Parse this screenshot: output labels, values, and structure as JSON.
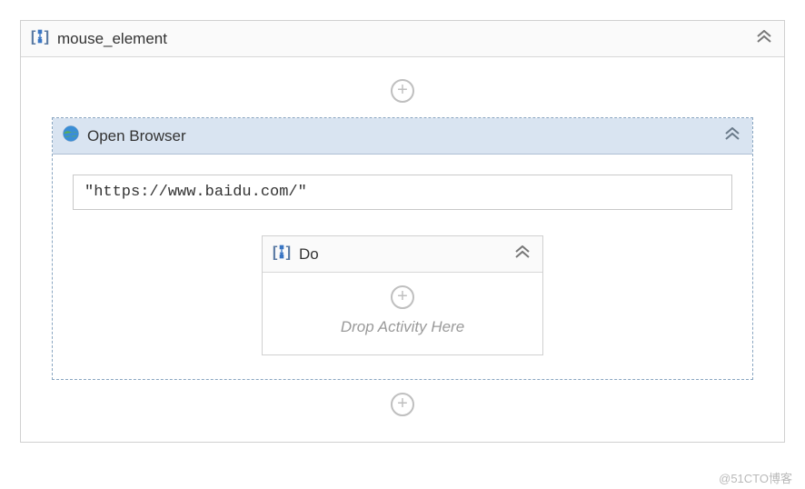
{
  "root": {
    "title": "mouse_element"
  },
  "browser": {
    "title": "Open Browser",
    "url_value": "\"https://www.baidu.com/\""
  },
  "do": {
    "title": "Do",
    "placeholder": "Drop Activity Here"
  },
  "watermark": "@51CTO博客"
}
